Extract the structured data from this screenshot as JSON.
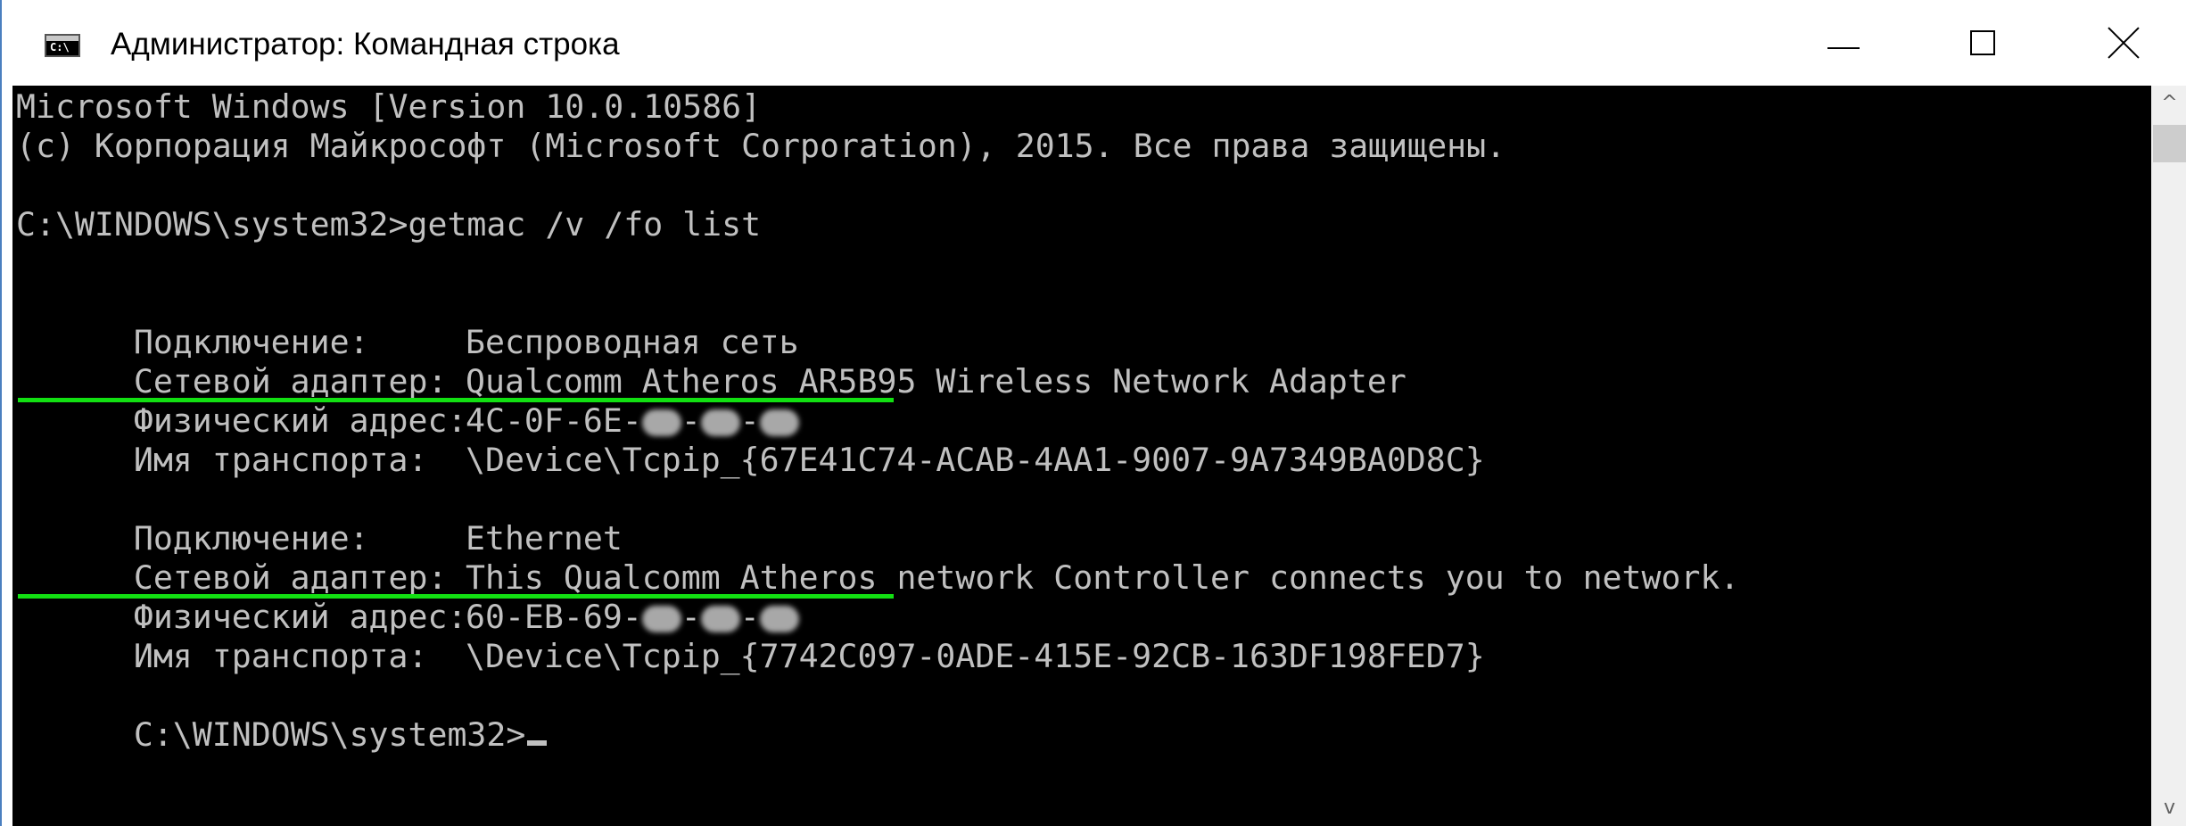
{
  "window": {
    "title": "Администратор: Командная строка",
    "icon_label": "C:\\",
    "icon": "cmd-icon",
    "minimize_icon": "minimize-icon",
    "maximize_icon": "maximize-icon",
    "close_icon": "close-icon"
  },
  "console": {
    "header_line1": "Microsoft Windows [Version 10.0.10586]",
    "header_line2": "(c) Корпорация Майкрософт (Microsoft Corporation), 2015. Все права защищены.",
    "command": "C:\\WINDOWS\\system32>getmac /v /fo list",
    "connections": [
      {
        "connection_label": "Подключение:",
        "connection_value": "Беспроводная сеть",
        "adapter_label": "Сетевой адаптер:",
        "adapter_value": "Qualcomm Atheros AR5B95 Wireless Network Adapter",
        "mac_label": "Физический адрес:",
        "mac_visible": "4C-0F-6E-",
        "transport_label": "Имя транспорта:",
        "transport_value": "\\Device\\Tcpip_{67E41C74-ACAB-4AA1-9007-9A7349BA0D8C}"
      },
      {
        "connection_label": "Подключение:",
        "connection_value": "Ethernet",
        "adapter_label": "Сетевой адаптер:",
        "adapter_value": "This Qualcomm Atheros network Controller connects you to network.",
        "mac_label": "Физический адрес:",
        "mac_visible": "60-EB-69-",
        "transport_label": "Имя транспорта:",
        "transport_value": "\\Device\\Tcpip_{7742C097-0ADE-415E-92CB-163DF198FED7}"
      }
    ],
    "prompt": "C:\\WINDOWS\\system32>",
    "mac_separator": "-",
    "highlight_color": "#12e012"
  },
  "scrollbar": {
    "up_arrow": "^",
    "down_arrow": "v"
  }
}
